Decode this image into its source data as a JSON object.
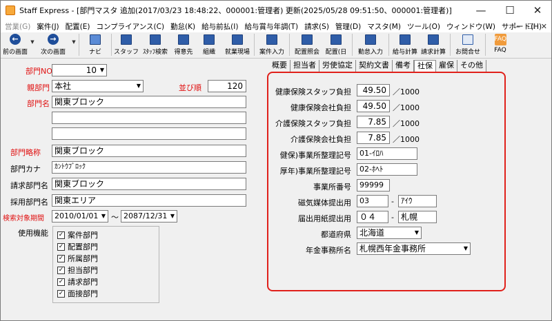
{
  "window": {
    "title": "Staff Express - [部門マスタ 追加(2017/03/23 18:48:22、000001:管理者) 更新(2025/05/28 09:51:50、000001:管理者)]",
    "minimize": "—",
    "maximize": "☐",
    "close": "✕"
  },
  "menu": {
    "items": [
      "営業(G)",
      "案件(J)",
      "配置(E)",
      "コンプライアンス(C)",
      "勤怠(K)",
      "給与前払(I)",
      "給与賞与年調(T)",
      "請求(S)",
      "管理(D)",
      "マスタ(M)",
      "ツール(O)",
      "ウィンドウ(W)",
      "サポート(H)"
    ],
    "right": [
      "—",
      "☐",
      "✕"
    ]
  },
  "toolbar": {
    "back": "前の画面",
    "next": "次の画面",
    "navi": "ナビ",
    "staff": "スタッフ",
    "staff_search": "ｽﾀｯﾌ検索",
    "client": "得意先",
    "org": "組織",
    "site": "就業現場",
    "case_input": "案件入力",
    "assign_inquiry": "配置照会",
    "assign_day": "配置(日",
    "attendance": "勤怠入力",
    "payroll": "給与計算",
    "billing": "請求計算",
    "contact": "お問合せ",
    "faq": "FAQ",
    "faq_icon": "FAQ"
  },
  "form": {
    "dept_no_label": "部門NO",
    "dept_no": "10",
    "parent_label": "親部門",
    "parent": "本社",
    "order_label": "並び順",
    "order": "120",
    "dept_name_label": "部門名",
    "dept_name": "関東ブロック",
    "dept_name2": "",
    "dept_name3": "",
    "short_label": "部門略称",
    "short": "関東ブロック",
    "kana_label": "部門カナ",
    "kana": "ｶﾝﾄｳﾌﾞﾛｯｸ",
    "billing_label": "請求部門名",
    "billing": "関東ブロック",
    "hiring_label": "採用部門名",
    "hiring": "関東エリア",
    "period_label": "検索対象期間",
    "period_from": "2010/01/01",
    "period_sep": "～",
    "period_to": "2087/12/31",
    "functions_label": "使用機能",
    "functions": [
      {
        "label": "案件部門",
        "checked": true
      },
      {
        "label": "配置部門",
        "checked": true
      },
      {
        "label": "所属部門",
        "checked": true
      },
      {
        "label": "担当部門",
        "checked": true
      },
      {
        "label": "請求部門",
        "checked": true
      },
      {
        "label": "面接部門",
        "checked": true
      }
    ]
  },
  "tabs": [
    "概要",
    "担当者",
    "労使協定",
    "契約文書",
    "備考",
    "社保",
    "雇保",
    "その他"
  ],
  "insurance": {
    "health_staff_label": "健康保険スタッフ負担",
    "health_staff": "49.50",
    "health_company_label": "健康保険会社負担",
    "health_company": "49.50",
    "care_staff_label": "介護保険スタッフ負担",
    "care_staff": "7.85",
    "care_company_label": "介護保険会社負担",
    "care_company": "7.85",
    "unit": "／1000",
    "health_office_label": "健保)事業所整理記号",
    "health_office": "01-ｲﾛﾊ",
    "pension_office_label": "厚年)事業所整理記号",
    "pension_office": "02-ﾎﾍﾄ",
    "office_no_label": "事業所番号",
    "office_no": "99999",
    "magnetic_label": "磁気媒体提出用",
    "magnetic_a": "03",
    "magnetic_dash": "-",
    "magnetic_b": "ｱｲｳ",
    "paper_label": "届出用紙提出用",
    "paper_a": "０４",
    "paper_dash": "-",
    "paper_b": "札幌",
    "prefecture_label": "都道府県",
    "prefecture": "北海道",
    "pension_office_name_label": "年金事務所名",
    "pension_office_name": "札幌西年金事務所"
  }
}
